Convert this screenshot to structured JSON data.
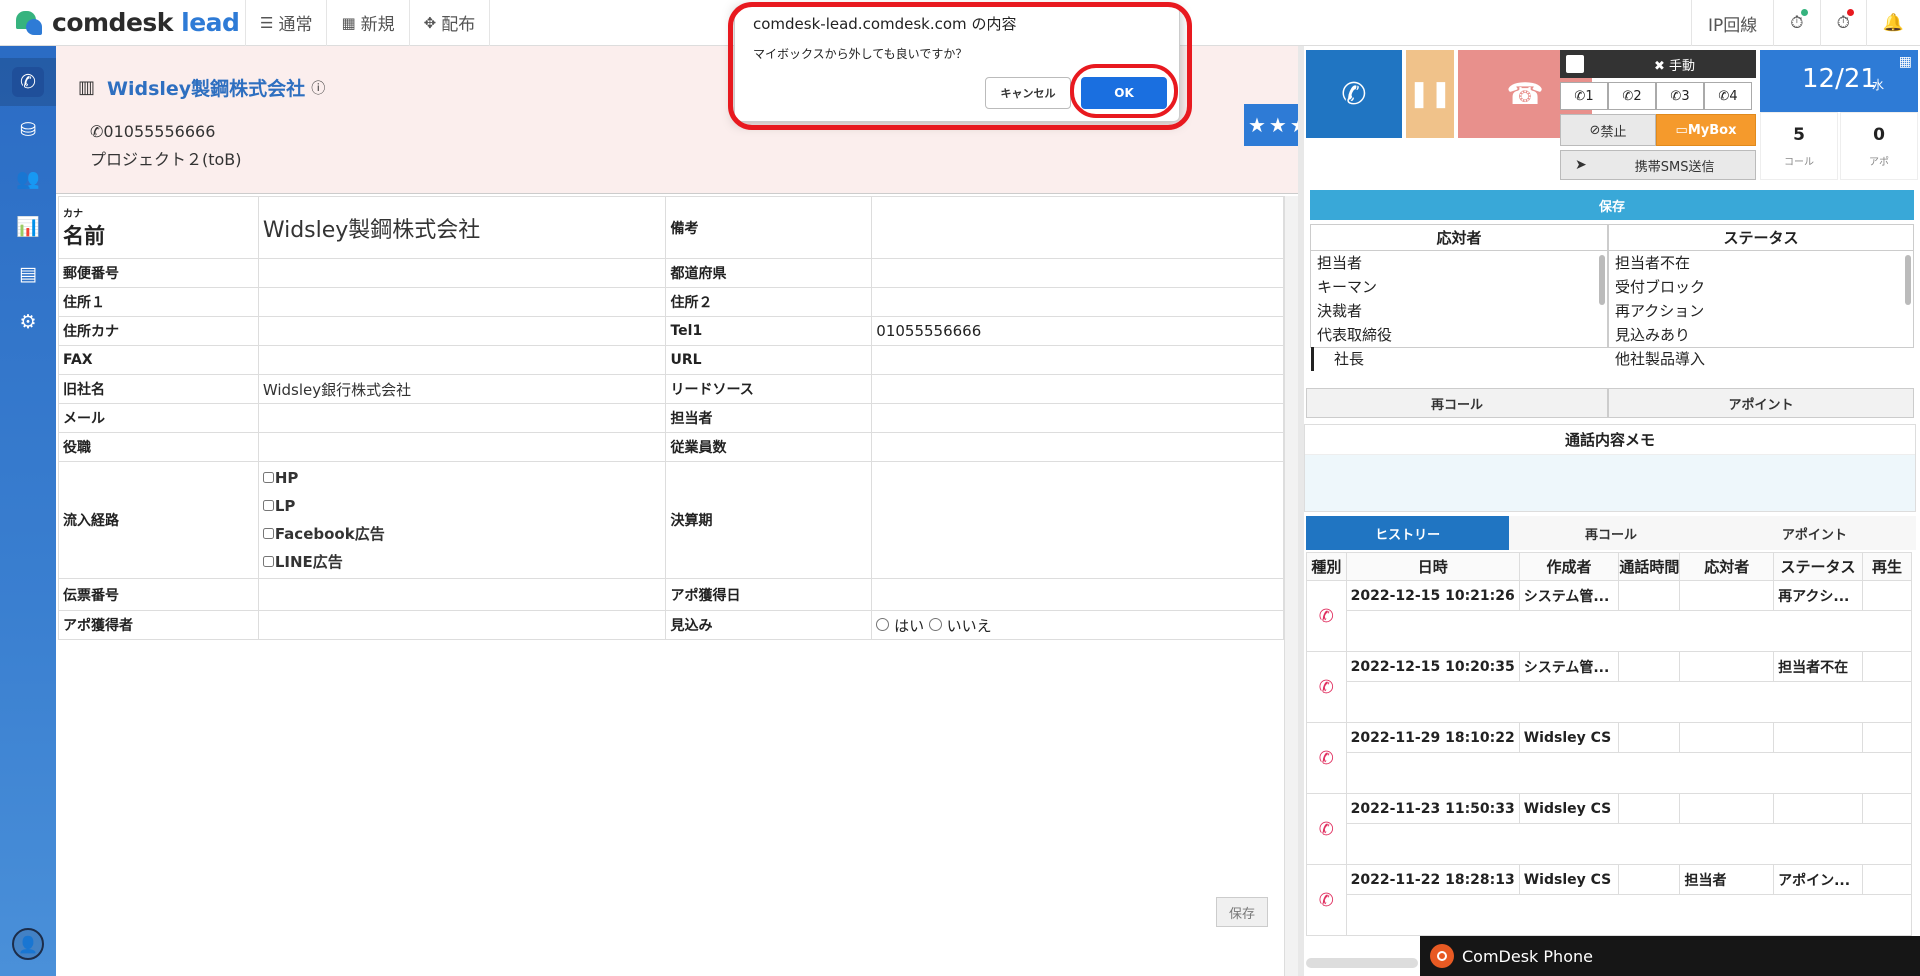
{
  "brand": {
    "name": "comdesk",
    "suffix": "lead"
  },
  "topnav": [
    {
      "icon": "list-icon",
      "label": "通常"
    },
    {
      "icon": "grid-icon",
      "label": "新規"
    },
    {
      "icon": "expand-icon",
      "label": "配布"
    }
  ],
  "topright": {
    "ip_line": "IP回線"
  },
  "company": {
    "name": "Widsley製鋼株式会社",
    "phone": "01055556666",
    "project": "プロジェクト２(toB)",
    "stars": "★★★★★"
  },
  "form": {
    "kana_label": "カナ",
    "name_label": "名前",
    "name_value": "Widsley製鋼株式会社",
    "notes_label": "備考",
    "rows": [
      {
        "l1": "郵便番号",
        "v1": "",
        "l2": "都道府県",
        "v2": ""
      },
      {
        "l1": "住所１",
        "v1": "",
        "l2": "住所２",
        "v2": ""
      },
      {
        "l1": "住所カナ",
        "v1": "",
        "l2": "Tel1",
        "v2": "01055556666"
      },
      {
        "l1": "FAX",
        "v1": "",
        "l2": "URL",
        "v2": ""
      },
      {
        "l1": "旧社名",
        "v1": "Widsley銀行株式会社",
        "l2": "リードソース",
        "v2": ""
      },
      {
        "l1": "メール",
        "v1": "",
        "l2": "担当者",
        "v2": ""
      },
      {
        "l1": "役職",
        "v1": "",
        "l2": "従業員数",
        "v2": ""
      }
    ],
    "source_label": "流入経路",
    "source_options": [
      "HP",
      "LP",
      "Facebook広告",
      "LINE広告"
    ],
    "settlement_label": "決算期",
    "slip_label": "伝票番号",
    "apo_date_label": "アポ獲得日",
    "apo_getter_label": "アポ獲得者",
    "prospect_label": "見込み",
    "prospect_yes": "はい",
    "prospect_no": "いいえ",
    "save_label": "保存"
  },
  "right": {
    "manual_label": "手動",
    "lines": [
      "1",
      "2",
      "3",
      "4"
    ],
    "ban_label": "禁止",
    "mybox_label": "MyBox",
    "sms_label": "携帯SMS送信",
    "date": "12/21",
    "dow": "水",
    "call_count": "5",
    "call_label": "コール",
    "apo_count": "0",
    "apo_label": "アポ",
    "save_label": "保存",
    "responder_head": "応対者",
    "responders": [
      "担当者",
      "キーマン",
      "決裁者",
      "代表取締役",
      "社長"
    ],
    "status_head": "ステータス",
    "statuses": [
      "担当者不在",
      "受付ブロック",
      "再アクション",
      "見込みあり",
      "他社製品導入"
    ],
    "recall_label": "再コール",
    "appoint_label": "アポイント",
    "memo_head": "通話内容メモ",
    "tabs": [
      "ヒストリー",
      "再コール",
      "アポイント"
    ],
    "hist_headers": [
      "種別",
      "日時",
      "作成者",
      "通話時間",
      "応対者",
      "ステータス",
      "再生"
    ],
    "history": [
      {
        "datetime": "2022-12-15 10:21:26",
        "author": "システム管...",
        "duration": "",
        "responder": "",
        "status": "再アクシ...",
        "play": ""
      },
      {
        "datetime": "2022-12-15 10:20:35",
        "author": "システム管...",
        "duration": "",
        "responder": "",
        "status": "担当者不在",
        "play": ""
      },
      {
        "datetime": "2022-11-29 18:10:22",
        "author": "Widsley CS",
        "duration": "",
        "responder": "",
        "status": "",
        "play": ""
      },
      {
        "datetime": "2022-11-23 11:50:33",
        "author": "Widsley CS",
        "duration": "",
        "responder": "",
        "status": "",
        "play": ""
      },
      {
        "datetime": "2022-11-22 18:28:13",
        "author": "Widsley CS",
        "duration": "",
        "responder": "担当者",
        "status": "アポイン...",
        "play": ""
      }
    ]
  },
  "phone_bar": {
    "label": "ComDesk Phone"
  },
  "dialog": {
    "title": "comdesk-lead.comdesk.com の内容",
    "message": "マイボックスから外しても良いですか？",
    "cancel_label": "キャンセル",
    "ok_label": "OK"
  },
  "colors": {
    "accent": "#2e7bd6",
    "highlight": "#e8191f",
    "mybox": "#f59a2c",
    "hangup": "#e8908c"
  }
}
